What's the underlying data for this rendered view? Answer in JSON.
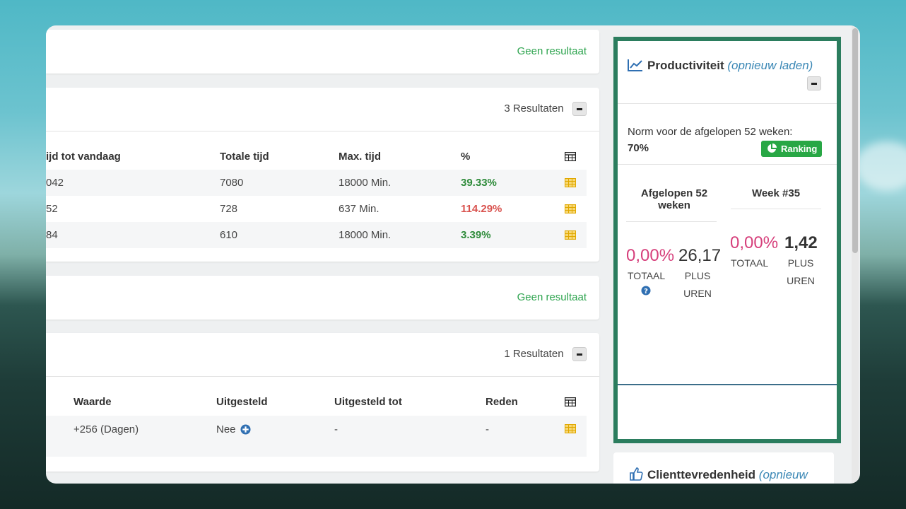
{
  "cards": {
    "card1": {
      "status": "Geen resultaat"
    },
    "card2": {
      "count": "3 Resultaten",
      "headers": [
        "ijd tot vandaag",
        "Totale tijd",
        "Max. tijd",
        "%"
      ],
      "rows": [
        [
          "042",
          "7080",
          "18000 Min.",
          "39.33%"
        ],
        [
          "52",
          "728",
          "637 Min.",
          "114.29%"
        ],
        [
          "84",
          "610",
          "18000 Min.",
          "3.39%"
        ]
      ]
    },
    "card3": {
      "status": "Geen resultaat"
    },
    "card4": {
      "count": "1 Resultaten",
      "headers": [
        "Waarde",
        "Uitgesteld",
        "Uitgesteld tot",
        "Reden"
      ],
      "rows": [
        [
          "+256 (Dagen)",
          "Nee",
          "-",
          "-"
        ]
      ]
    }
  },
  "productivity": {
    "title": "Productiviteit",
    "reload": "(opnieuw laden)",
    "norm_label": "Norm voor de afgelopen 52 weken:",
    "norm_value": "70%",
    "ranking": "Ranking",
    "col1_head": "Afgelopen 52 weken",
    "col2_head": "Week #35",
    "col1_pct": "0,00%",
    "col1_pct_label": "TOTAAL",
    "col1_hours": "26,17",
    "col1_hours_label1": "PLUS",
    "col1_hours_label2": "UREN",
    "col2_pct": "0,00%",
    "col2_pct_label": "TOTAAL",
    "col2_hours": "1,42",
    "col2_hours_label1": "PLUS",
    "col2_hours_label2": "UREN"
  },
  "client": {
    "title": "Clienttevredenheid",
    "reload": "(opnieuw"
  },
  "colors": {
    "panel_border": "#2b7d5e",
    "green": "#2ea44f",
    "red": "#d9534f",
    "pink": "#d63f7b",
    "link_blue": "#3a87b5"
  }
}
